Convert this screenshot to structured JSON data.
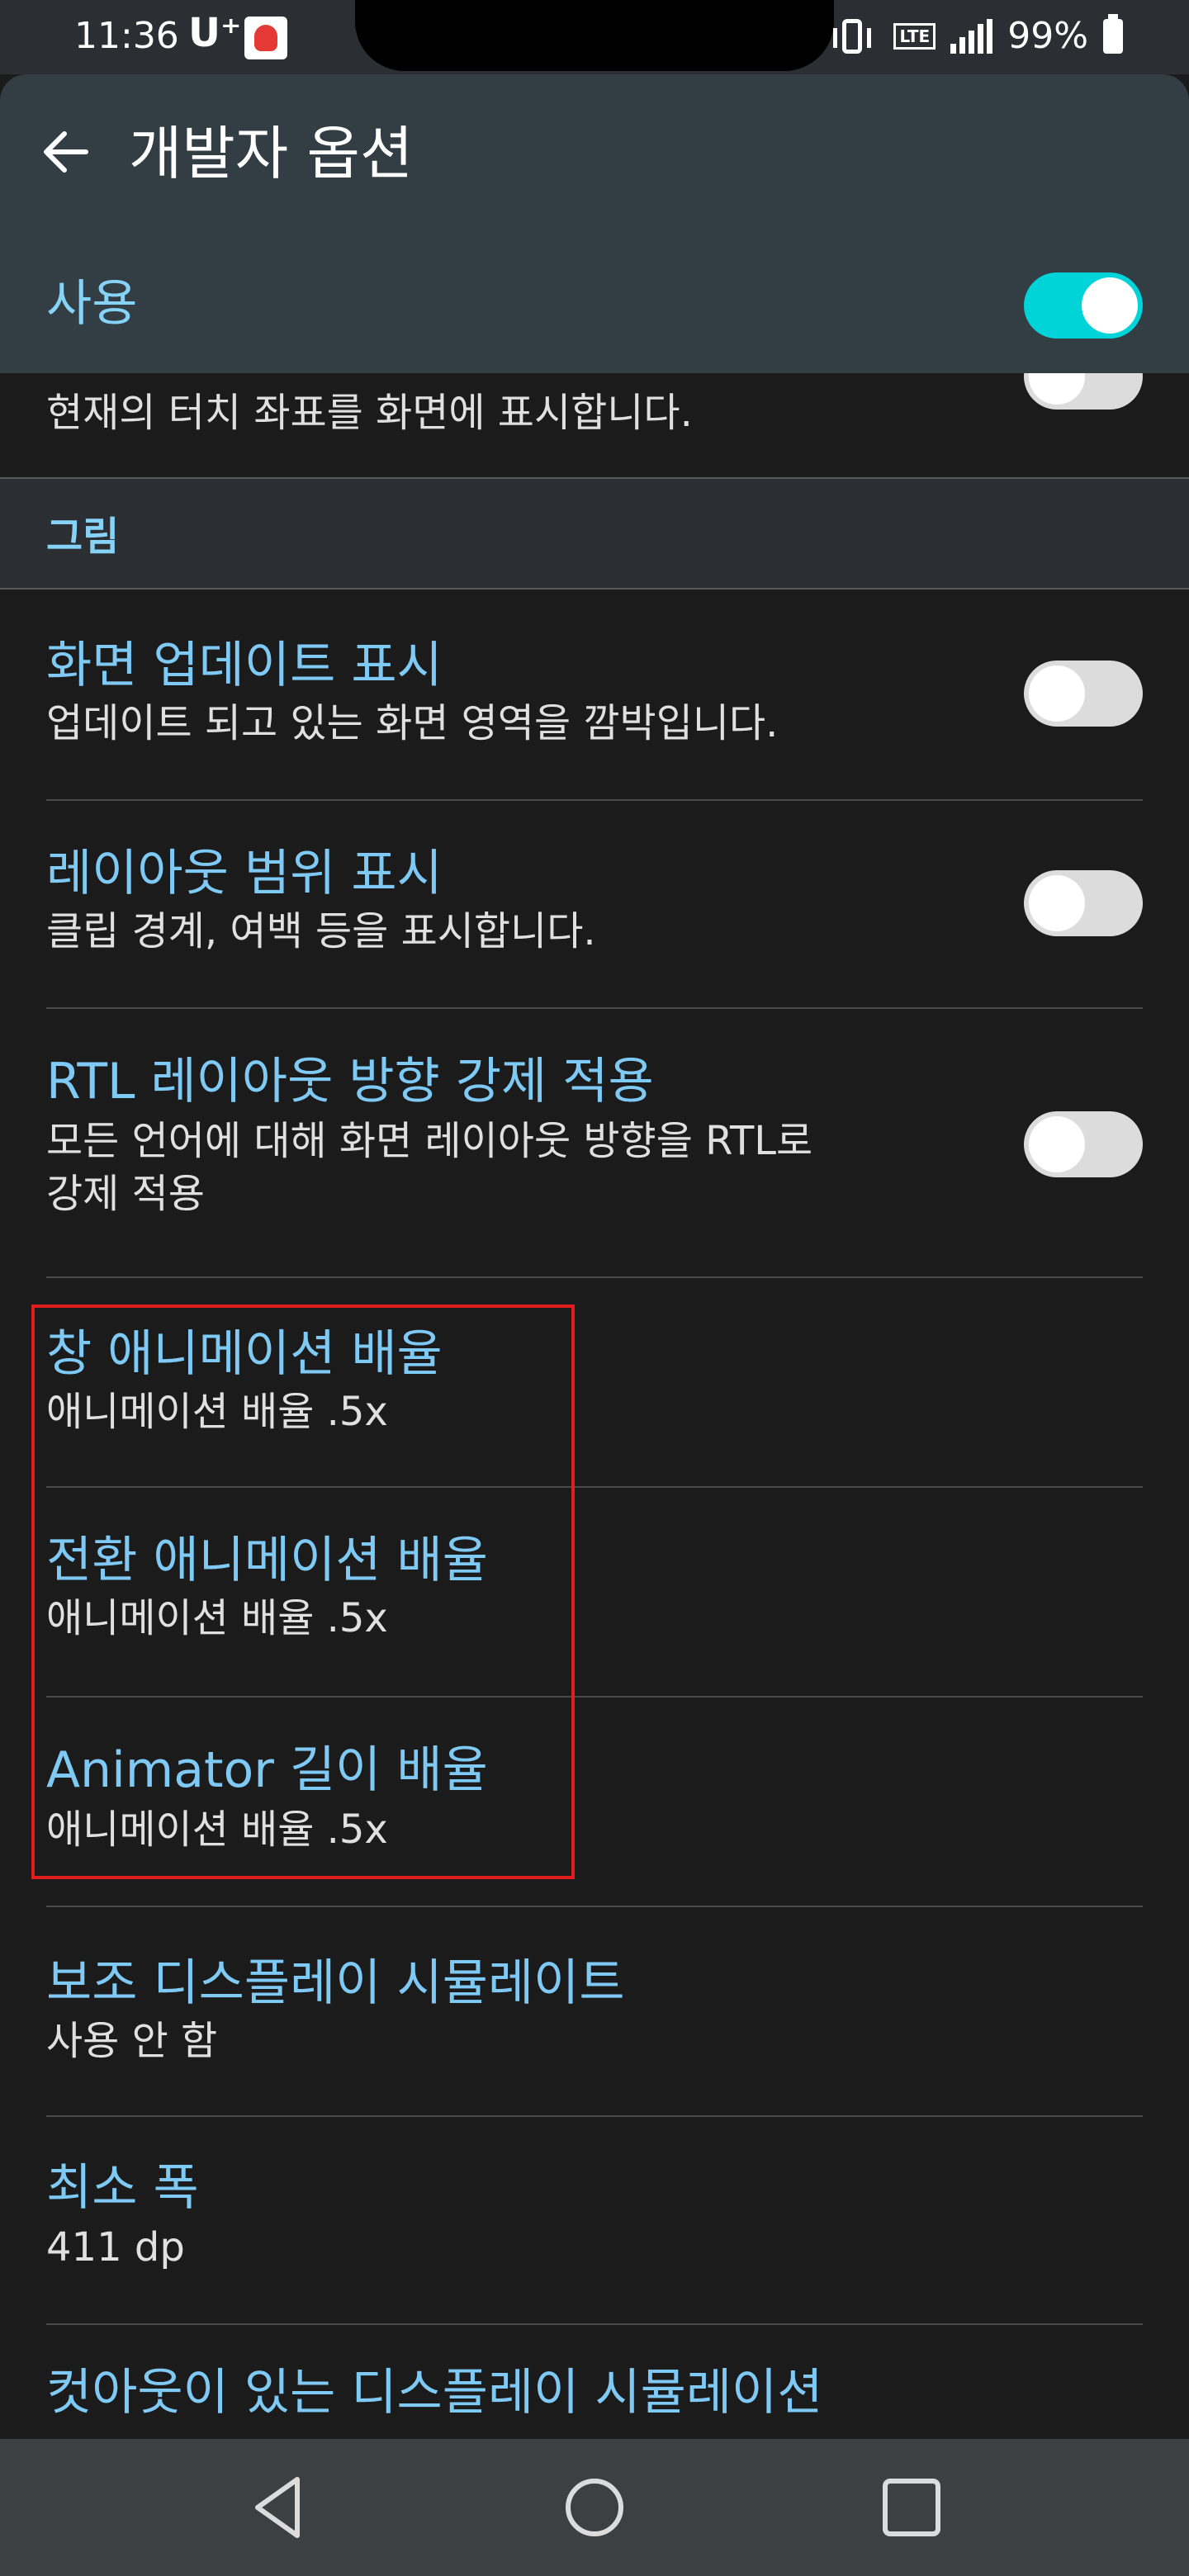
{
  "status_bar": {
    "time": "11:36",
    "carrier": "U⁺",
    "network": "LTE",
    "battery": "99%"
  },
  "app_bar": {
    "title": "개발자 옵션",
    "back_icon": "arrow-back-icon"
  },
  "master_switch": {
    "label": "사용",
    "on": true
  },
  "partial_item": {
    "summary": "현재의 터치 좌표를 화면에 표시합니다.",
    "on": false
  },
  "category": {
    "label": "그림"
  },
  "items": [
    {
      "title": "화면 업데이트 표시",
      "summary": "업데이트 되고 있는 화면 영역을 깜박입니다.",
      "toggle": false
    },
    {
      "title": "레이아웃 범위 표시",
      "summary": "클립 경계, 여백 등을 표시합니다.",
      "toggle": false
    },
    {
      "title": "RTL 레이아웃 방향 강제 적용",
      "summary_line1": "모든 언어에 대해 화면 레이아웃 방향을 RTL로",
      "summary_line2": "강제 적용",
      "toggle": false
    },
    {
      "title": "창 애니메이션 배율",
      "summary": "애니메이션 배율 .5x"
    },
    {
      "title": "전환 애니메이션 배율",
      "summary": "애니메이션 배율 .5x"
    },
    {
      "title": "Animator 길이 배율",
      "summary": "애니메이션 배율 .5x"
    },
    {
      "title": "보조 디스플레이 시뮬레이트",
      "summary": "사용 안 함"
    },
    {
      "title": "최소 폭",
      "summary": "411 dp"
    },
    {
      "title": "컷아웃이 있는 디스플레이 시뮬레이션"
    }
  ],
  "colors": {
    "accent_toggle": "#00d4d8",
    "title_text": "#7fcaf5",
    "highlight_box": "#e11d1d",
    "background": "#1b1b1b",
    "app_bar": "#333d44"
  },
  "nav_bar": {
    "back": "triangle-back-icon",
    "home": "circle-home-icon",
    "recents": "square-recents-icon"
  }
}
